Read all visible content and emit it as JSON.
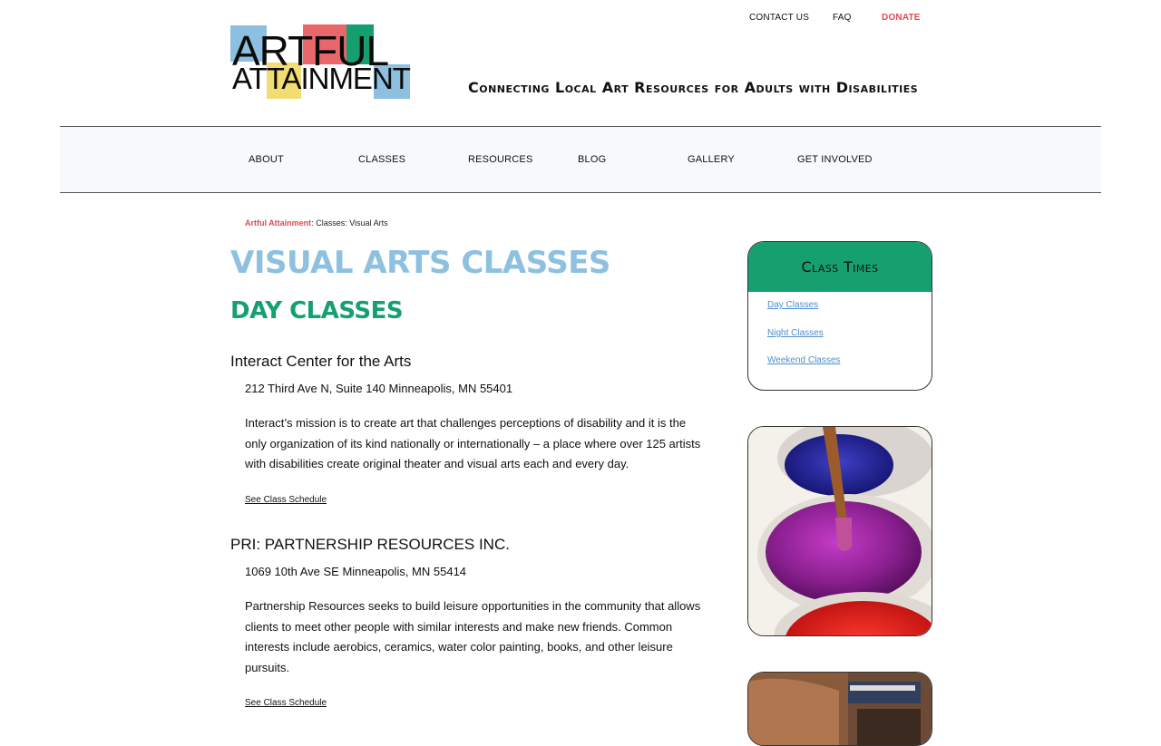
{
  "logo": {
    "line1": "ARTFUL",
    "line2": "ATTAINMENT"
  },
  "top_nav": {
    "contact": "CONTACT US",
    "faq": "FAQ",
    "donate": "DONATE"
  },
  "tagline": "Connecting Local Art Resources for Adults with Disabilities",
  "main_nav": [
    "ABOUT",
    "CLASSES",
    "RESOURCES",
    "BLOG",
    "GALLERY",
    "GET INVOLVED"
  ],
  "breadcrumb": {
    "home": "Artful Attainment",
    "sep": ":",
    "path": "Classes: Visual Arts"
  },
  "page_title": "VISUAL ARTS CLASSES",
  "section_title": "DAY CLASSES",
  "orgs": [
    {
      "name": "Interact Center for the Arts",
      "address": "212 Third Ave N, Suite 140 Minneapolis, MN 55401",
      "description": "Interact’s mission is to create art that challenges perceptions of disability and it is the only organization of its kind nationally or internationally – a place where over 125 artists with disabilities create original theater and visual arts each and every day.",
      "link": "See Class Schedule"
    },
    {
      "name": "PRI: PARTNERSHIP RESOURCES INC.",
      "address": "1069 10th Ave SE Minneapolis, MN 55414",
      "description": "Partnership Resources seeks to build leisure opportunities in the community that allows clients to meet other people with similar interests and make new friends. Common interests include aerobics, ceramics, water color painting, books, and other leisure pursuits.",
      "link": "See Class Schedule"
    }
  ],
  "sidebar": {
    "class_times": {
      "title": "Class Times",
      "links": [
        "Day Classes",
        "Night Classes",
        "Weekend Classes"
      ]
    }
  },
  "colors": {
    "accent_red": "#e04a4e",
    "title_blue": "#8ec0e0",
    "title_green": "#16a06f",
    "link_blue": "#4a8fcf"
  }
}
